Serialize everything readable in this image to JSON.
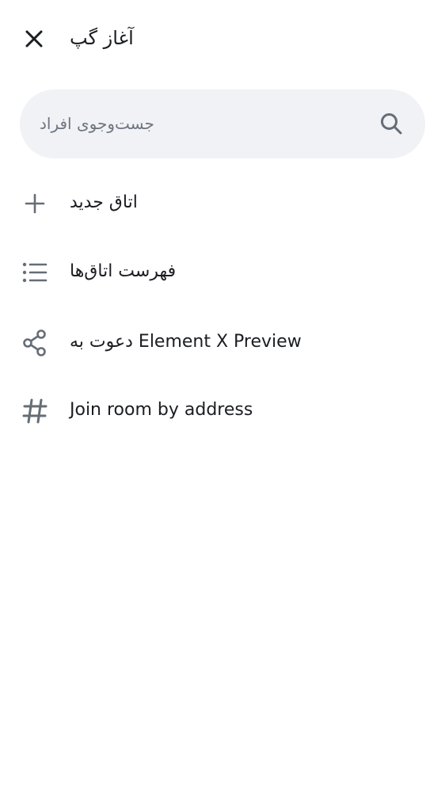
{
  "header": {
    "title": "آغاز گپ",
    "close_icon": "close-icon"
  },
  "search": {
    "placeholder": "جست‌وجوی افراد",
    "icon": "search-icon"
  },
  "menu": {
    "items": [
      {
        "label": "اتاق جدید",
        "icon": "plus-icon"
      },
      {
        "label": "فهرست اتاق‌ها",
        "icon": "list-icon"
      },
      {
        "label": "دعوت به Element X Preview",
        "icon": "share-icon"
      },
      {
        "label": "Join room by address",
        "icon": "hash-icon"
      }
    ]
  },
  "colors": {
    "text": "#1b1d22",
    "icon": "#656d77",
    "search_bg": "#f0f2f5",
    "placeholder": "#6f7580"
  }
}
